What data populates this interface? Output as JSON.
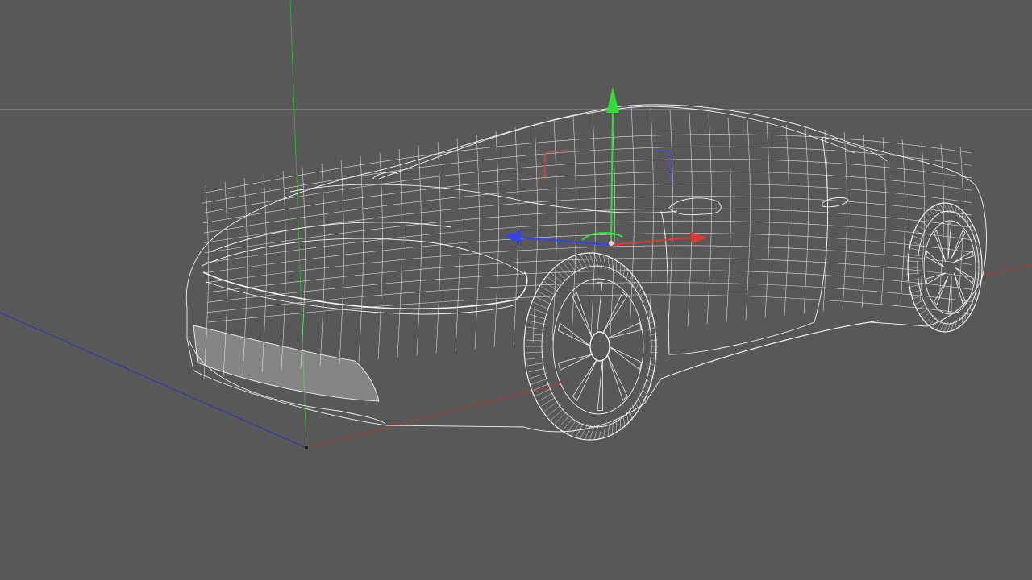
{
  "viewport": {
    "background": "#585858",
    "wire_color": "#f2f2f2"
  },
  "world_axes": {
    "x_color": "#b03a2e",
    "y_color": "#33aa33",
    "z_color": "#2b35b5"
  },
  "gizmo": {
    "tool": "move",
    "x_color": "#e03a33",
    "y_color": "#33dd33",
    "z_color": "#3344ee"
  },
  "model": {
    "type": "sports-car-wireframe"
  }
}
